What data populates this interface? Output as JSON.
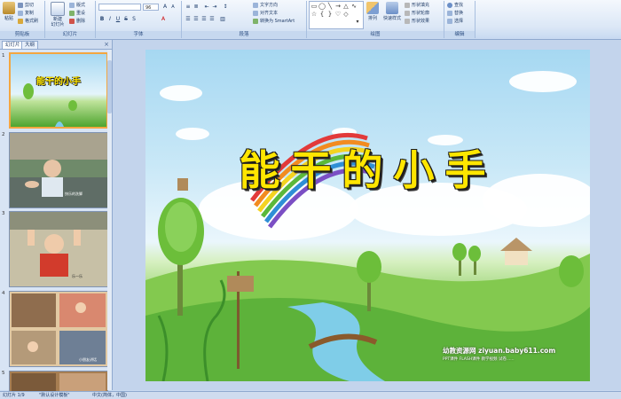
{
  "ribbon": {
    "clipboard": {
      "label": "剪贴板",
      "paste": "粘贴",
      "cut": "剪切",
      "copy": "复制",
      "format": "格式刷"
    },
    "slides": {
      "label": "幻灯片",
      "new": "新建\n幻灯片",
      "layout": "版式",
      "reset": "重设",
      "delete": "删除"
    },
    "font": {
      "label": "字体",
      "size": "96"
    },
    "paragraph": {
      "label": "段落",
      "text_direction": "文字方向",
      "align_text": "对齐文本",
      "smartart": "转换为 SmartArt"
    },
    "drawing": {
      "label": "绘图",
      "arrange": "排列",
      "quick_styles": "快速样式",
      "fill": "形状填充",
      "outline": "形状轮廓",
      "effects": "形状效果"
    },
    "editing": {
      "label": "编辑",
      "find": "查找",
      "replace": "替换",
      "select": "选择"
    }
  },
  "pane": {
    "tabs": [
      "幻灯片",
      "大纲"
    ],
    "close": "×",
    "slide_numbers": [
      "1",
      "2",
      "3",
      "4",
      "5"
    ],
    "thumb2_caption": "快乐的洗脚",
    "thumb3_caption": "乐一乐",
    "thumb4_caption": "小朋友讲话"
  },
  "slide": {
    "title": "能干的小手",
    "watermark_main": "幼教资源网 ziyuan.baby611.com",
    "watermark_sub": "PPT课件 FLASH课件 教学视频 试卷......"
  },
  "status": {
    "slide_count": "幻灯片 1/9",
    "theme": "\"默认设计模板\"",
    "language": "中文(简体，中国)"
  },
  "colors": {
    "accent_title": "#ffe600",
    "selection": "#f4a640",
    "ribbon_text": "#1e3a66"
  }
}
